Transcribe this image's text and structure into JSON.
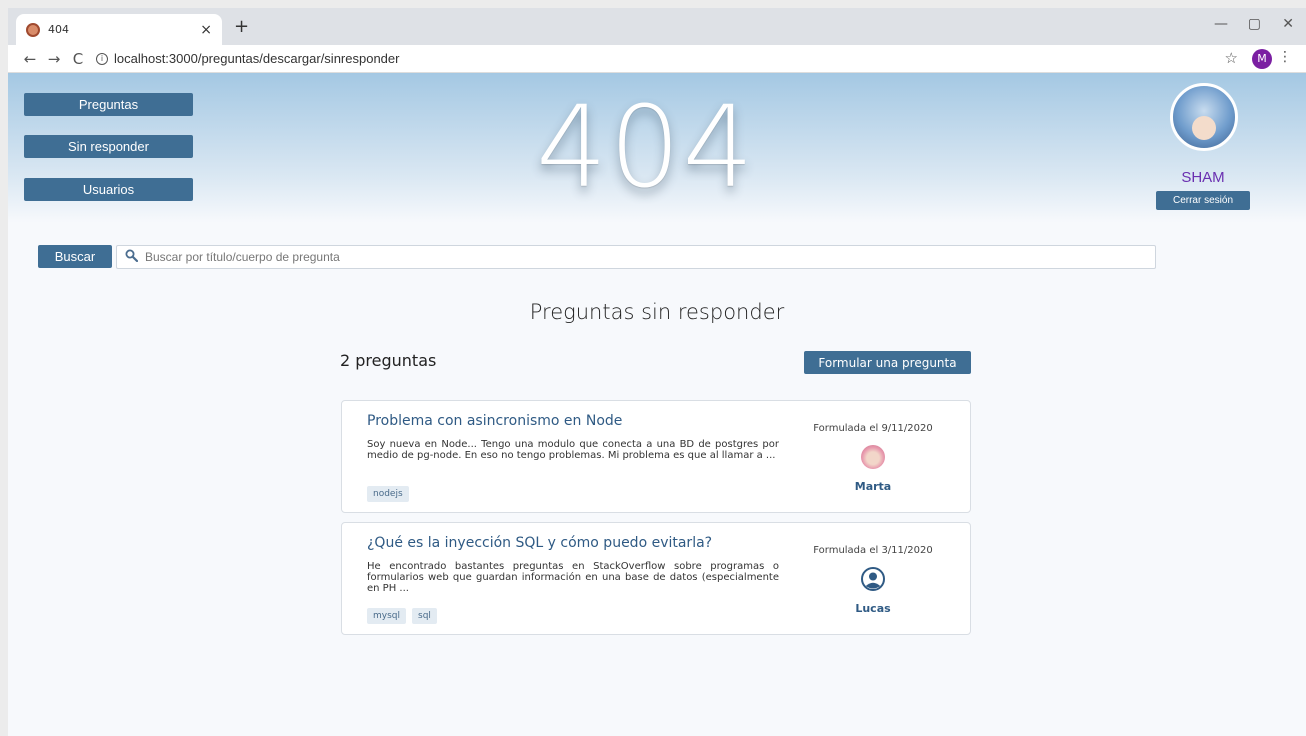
{
  "browser": {
    "tab_title": "404",
    "tab_close": "×",
    "new_tab": "+",
    "url": "localhost:3000/preguntas/descargar/sinresponder",
    "profile_initial": "M",
    "controls": {
      "back": "←",
      "forward": "→",
      "reload": "C",
      "star": "☆",
      "menu": "⋮",
      "minimize": "—",
      "maximize": "▢",
      "close": "✕"
    }
  },
  "nav": {
    "items": [
      "Preguntas",
      "Sin responder",
      "Usuarios"
    ]
  },
  "header": {
    "banner": "404"
  },
  "user": {
    "name": "SHAM",
    "logout_label": "Cerrar sesión"
  },
  "search": {
    "button_label": "Buscar",
    "placeholder": "Buscar por título/cuerpo de pregunta"
  },
  "main": {
    "title": "Preguntas sin responder",
    "count_label": "2 preguntas",
    "ask_button": "Formular una pregunta"
  },
  "questions": [
    {
      "title": "Problema con asincronismo en Node",
      "body": "Soy nueva en Node... Tengo una modulo que conecta a una BD de postgres por medio de pg-node. En eso no tengo problemas. Mi problema es que al llamar a ...",
      "tags": [
        "nodejs"
      ],
      "date": "Formulada el 9/11/2020",
      "author": "Marta"
    },
    {
      "title": "¿Qué es la inyección SQL y cómo puedo evitarla?",
      "body": "He encontrado bastantes preguntas en StackOverflow sobre programas o formularios web que guardan información en una base de datos (especialmente en PH ...",
      "tags": [
        "mysql",
        "sql"
      ],
      "date": "Formulada el 3/11/2020",
      "author": "Lucas"
    }
  ],
  "colors": {
    "primary": "#3f6e94",
    "link": "#2f5a84",
    "username": "#6a2fb0",
    "profile": "#7b1fa2"
  }
}
